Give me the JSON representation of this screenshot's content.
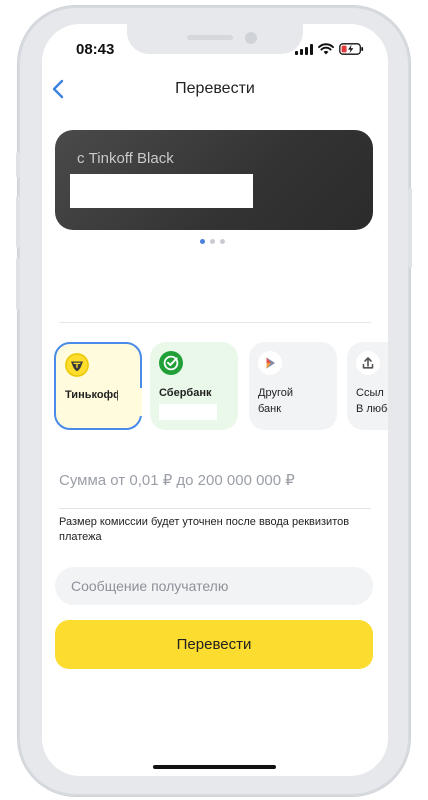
{
  "status_bar": {
    "time": "08:43",
    "icons": [
      "signal-icon",
      "wifi-icon",
      "battery-charging-icon"
    ]
  },
  "header": {
    "back_icon": "chevron-left-icon",
    "title": "Перевести"
  },
  "source_card": {
    "label": "с Tinkoff Black",
    "carousel_pages": 3,
    "active_page": 1
  },
  "banks": [
    {
      "name": "Тинькофф б",
      "subtitle": "",
      "icon": "tinkoff-logo-icon",
      "selected": true
    },
    {
      "name": "Сбербанк",
      "subtitle": "",
      "icon": "sberbank-logo-icon",
      "selected": false
    },
    {
      "name": "Другой",
      "subtitle": "банк",
      "icon": "other-bank-icon",
      "selected": false
    },
    {
      "name": "Ссыл",
      "subtitle": "В любо",
      "icon": "share-icon",
      "selected": false
    }
  ],
  "amount": {
    "placeholder": "Сумма от 0,01 ₽ до 200 000 000 ₽"
  },
  "fee_note": "Размер комиссии будет уточнен после ввода реквизитов платежа",
  "message": {
    "placeholder": "Сообщение получателю"
  },
  "submit_label": "Перевести",
  "colors": {
    "accent_blue": "#4a8ae8",
    "button_yellow": "#fcdc2f",
    "card_dark": "#3a3a3a",
    "sber_green": "#21a038"
  }
}
